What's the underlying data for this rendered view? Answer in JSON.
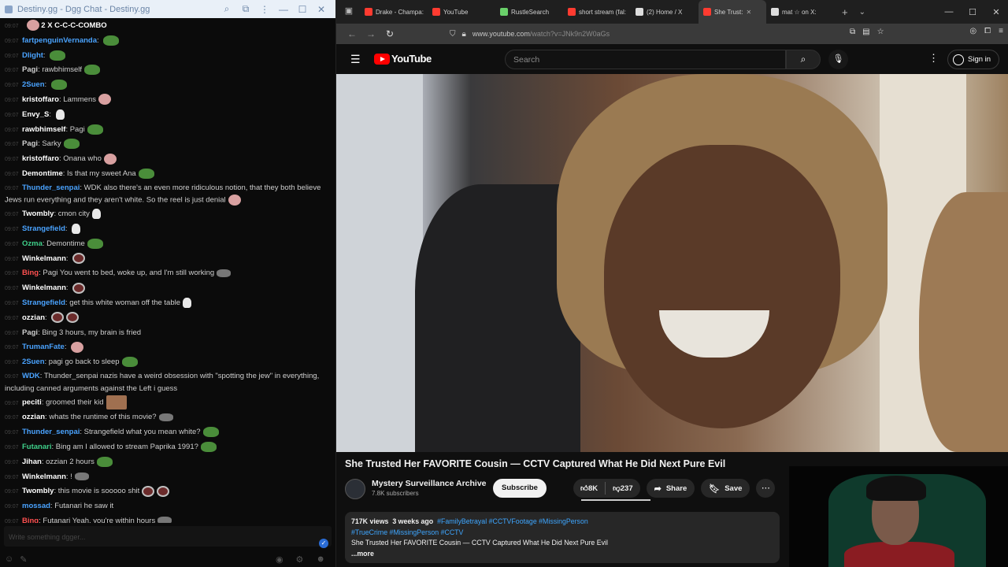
{
  "chat": {
    "window_title": "Destiny.gg - Dgg Chat - Destiny.gg",
    "combo": "2 X C-C-C-COMBO",
    "input_placeholder": "Write something dgger...",
    "messages": [
      {
        "ts": "09:07",
        "user": "fartpenguinVernanda",
        "color": "#4aa3ff",
        "text": "",
        "emotes": [
          "pepe"
        ]
      },
      {
        "ts": "09:07",
        "user": "Dlight",
        "color": "#4aa3ff",
        "text": "",
        "emotes": [
          "pepe"
        ]
      },
      {
        "ts": "09:07",
        "user": "Pagi",
        "color": "#d0d0d0",
        "text": "rawbhimself",
        "emotes": [
          "pepe"
        ]
      },
      {
        "ts": "09:07",
        "user": "2Suen",
        "color": "#4aa3ff",
        "text": "",
        "emotes": [
          "pepe"
        ]
      },
      {
        "ts": "09:07",
        "user": "kristoffaro",
        "color": "#ffffff",
        "text": "Lammens",
        "emotes": [
          "pink"
        ]
      },
      {
        "ts": "09:07",
        "user": "Envy_S",
        "color": "#ffffff",
        "text": "",
        "emotes": [
          "skull"
        ]
      },
      {
        "ts": "09:07",
        "user": "rawbhimself",
        "color": "#ffffff",
        "text": "Pagi",
        "emotes": [
          "pepe"
        ]
      },
      {
        "ts": "09:07",
        "user": "Pagi",
        "color": "#d0d0d0",
        "text": "Sarky",
        "emotes": [
          "pepe"
        ]
      },
      {
        "ts": "09:07",
        "user": "kristoffaro",
        "color": "#ffffff",
        "text": "Onana who",
        "emotes": [
          "pink"
        ]
      },
      {
        "ts": "09:07",
        "user": "Demontime",
        "color": "#ffffff",
        "text": "Is that my sweet Ana",
        "emotes": [
          "pepe"
        ]
      },
      {
        "ts": "09:07",
        "user": "Thunder_senpai",
        "color": "#4aa3ff",
        "text": "WDK also there's an even more ridiculous notion, that they both believe Jews run everything and they aren't white. So the reel is just denial",
        "emotes": [
          "pink"
        ],
        "wrap": true
      },
      {
        "ts": "09:07",
        "user": "Twombly",
        "color": "#ffffff",
        "text": "cmon city",
        "emotes": [
          "skull"
        ]
      },
      {
        "ts": "09:07",
        "user": "Strangefield",
        "color": "#4aa3ff",
        "text": "",
        "emotes": [
          "skull"
        ]
      },
      {
        "ts": "09:07",
        "user": "Ozma",
        "color": "#3fd08a",
        "text": "Demontime",
        "emotes": [
          "pepe"
        ]
      },
      {
        "ts": "09:07",
        "user": "Winkelmann",
        "color": "#ffffff",
        "text": "",
        "emotes": [
          "dark"
        ]
      },
      {
        "ts": "09:07",
        "user": "Bing",
        "color": "#ff5050",
        "text": "Pagi You went to bed, woke up, and I'm still working",
        "emotes": [
          "grey"
        ]
      },
      {
        "ts": "09:07",
        "user": "Winkelmann",
        "color": "#ffffff",
        "text": "",
        "emotes": [
          "dark"
        ]
      },
      {
        "ts": "09:07",
        "user": "Strangefield",
        "color": "#4aa3ff",
        "text": "get this white woman off the table",
        "emotes": [
          "skull"
        ]
      },
      {
        "ts": "09:07",
        "user": "ozzian",
        "color": "#ffffff",
        "text": "",
        "emotes": [
          "dark",
          "dark"
        ]
      },
      {
        "ts": "09:07",
        "user": "Pagi",
        "color": "#d0d0d0",
        "text": "Bing 3 hours, my brain is fried",
        "emotes": []
      },
      {
        "ts": "09:07",
        "user": "TrumanFate",
        "color": "#4aa3ff",
        "text": "",
        "emotes": [
          "pink"
        ]
      },
      {
        "ts": "09:07",
        "user": "2Suen",
        "color": "#4aa3ff",
        "text": "pagi go back to sleep",
        "emotes": [
          "pepe"
        ]
      },
      {
        "ts": "09:07",
        "user": "WDK",
        "color": "#4aa3ff",
        "text": "Thunder_senpai nazis have a weird obsession with \"spotting the jew\" in everything, including canned arguments against the Left i guess",
        "emotes": [],
        "wrap": true
      },
      {
        "ts": "09:07",
        "user": "peciti",
        "color": "#ffffff",
        "text": "groomed their kid",
        "emotes": [
          "face"
        ]
      },
      {
        "ts": "09:07",
        "user": "ozzian",
        "color": "#ffffff",
        "text": "whats the runtime of this movie?",
        "emotes": [
          "grey"
        ]
      },
      {
        "ts": "09:07",
        "user": "Thunder_senpai",
        "color": "#4aa3ff",
        "text": "Strangefield what you mean white?",
        "emotes": [
          "pepe"
        ]
      },
      {
        "ts": "09:07",
        "user": "Futanari",
        "color": "#3fd08a",
        "text": "Bing am I allowed to stream Paprika 1991?",
        "emotes": [
          "pepe"
        ]
      },
      {
        "ts": "09:07",
        "user": "Jihan",
        "color": "#ffffff",
        "text": "ozzian 2 hours",
        "emotes": [
          "pepe"
        ]
      },
      {
        "ts": "09:07",
        "user": "Winkelmann",
        "color": "#ffffff",
        "text": "!",
        "emotes": [
          "grey"
        ]
      },
      {
        "ts": "09:07",
        "user": "Twombly",
        "color": "#ffffff",
        "text": "this movie is sooooo shit",
        "emotes": [
          "dark",
          "dark"
        ]
      },
      {
        "ts": "09:07",
        "user": "mossad",
        "color": "#4aa3ff",
        "text": "Futanari he saw it",
        "emotes": []
      },
      {
        "ts": "09:07",
        "user": "Bing",
        "color": "#ff5050",
        "text": "Futanari Yeah, you're within hours",
        "emotes": [
          "grey"
        ]
      },
      {
        "ts": "09:07",
        "user": "Dlight",
        "color": "#4aa3ff",
        "text": "Twombly",
        "emotes": [
          "pepe"
        ]
      }
    ]
  },
  "browser": {
    "tabs": [
      {
        "label": "Drake - Champa:",
        "color": "#ff3b30"
      },
      {
        "label": "YouTube",
        "color": "#ff3b30"
      },
      {
        "label": "RustleSearch",
        "color": "#6ad06a"
      },
      {
        "label": "short stream (fal:",
        "color": "#ff3b30"
      },
      {
        "label": "(2) Home / X",
        "color": "#dddddd"
      },
      {
        "label": "She Trust:",
        "color": "#ff3b30",
        "active": true
      },
      {
        "label": "mat ☆ on X:",
        "color": "#dddddd"
      }
    ],
    "url_host": "www.youtube.com",
    "url_path": "/watch?v=JNk9n2W0aGs"
  },
  "youtube": {
    "logo_text": "YouTube",
    "search_placeholder": "Search",
    "signin_label": "Sign in",
    "video_title": "She Trusted Her FAVORITE Cousin — CCTV Captured What He Did Next Pure Evil",
    "channel_name": "Mystery Surveillance Archive",
    "channel_subs": "7.8K subscribers",
    "subscribe_label": "Subscribe",
    "likes": "8K",
    "dislikes": "237",
    "share_label": "Share",
    "save_label": "Save",
    "views": "717K views",
    "age": "3 weeks ago",
    "tags_line1": "#FamilyBetrayal #CCTVFootage #MissingPerson",
    "tags_line2": "#TrueCrime #MissingPerson #CCTV",
    "description_text": "She Trusted Her FAVORITE Cousin — CCTV Captured What He Did Next Pure Evil",
    "more_label": "...more"
  }
}
